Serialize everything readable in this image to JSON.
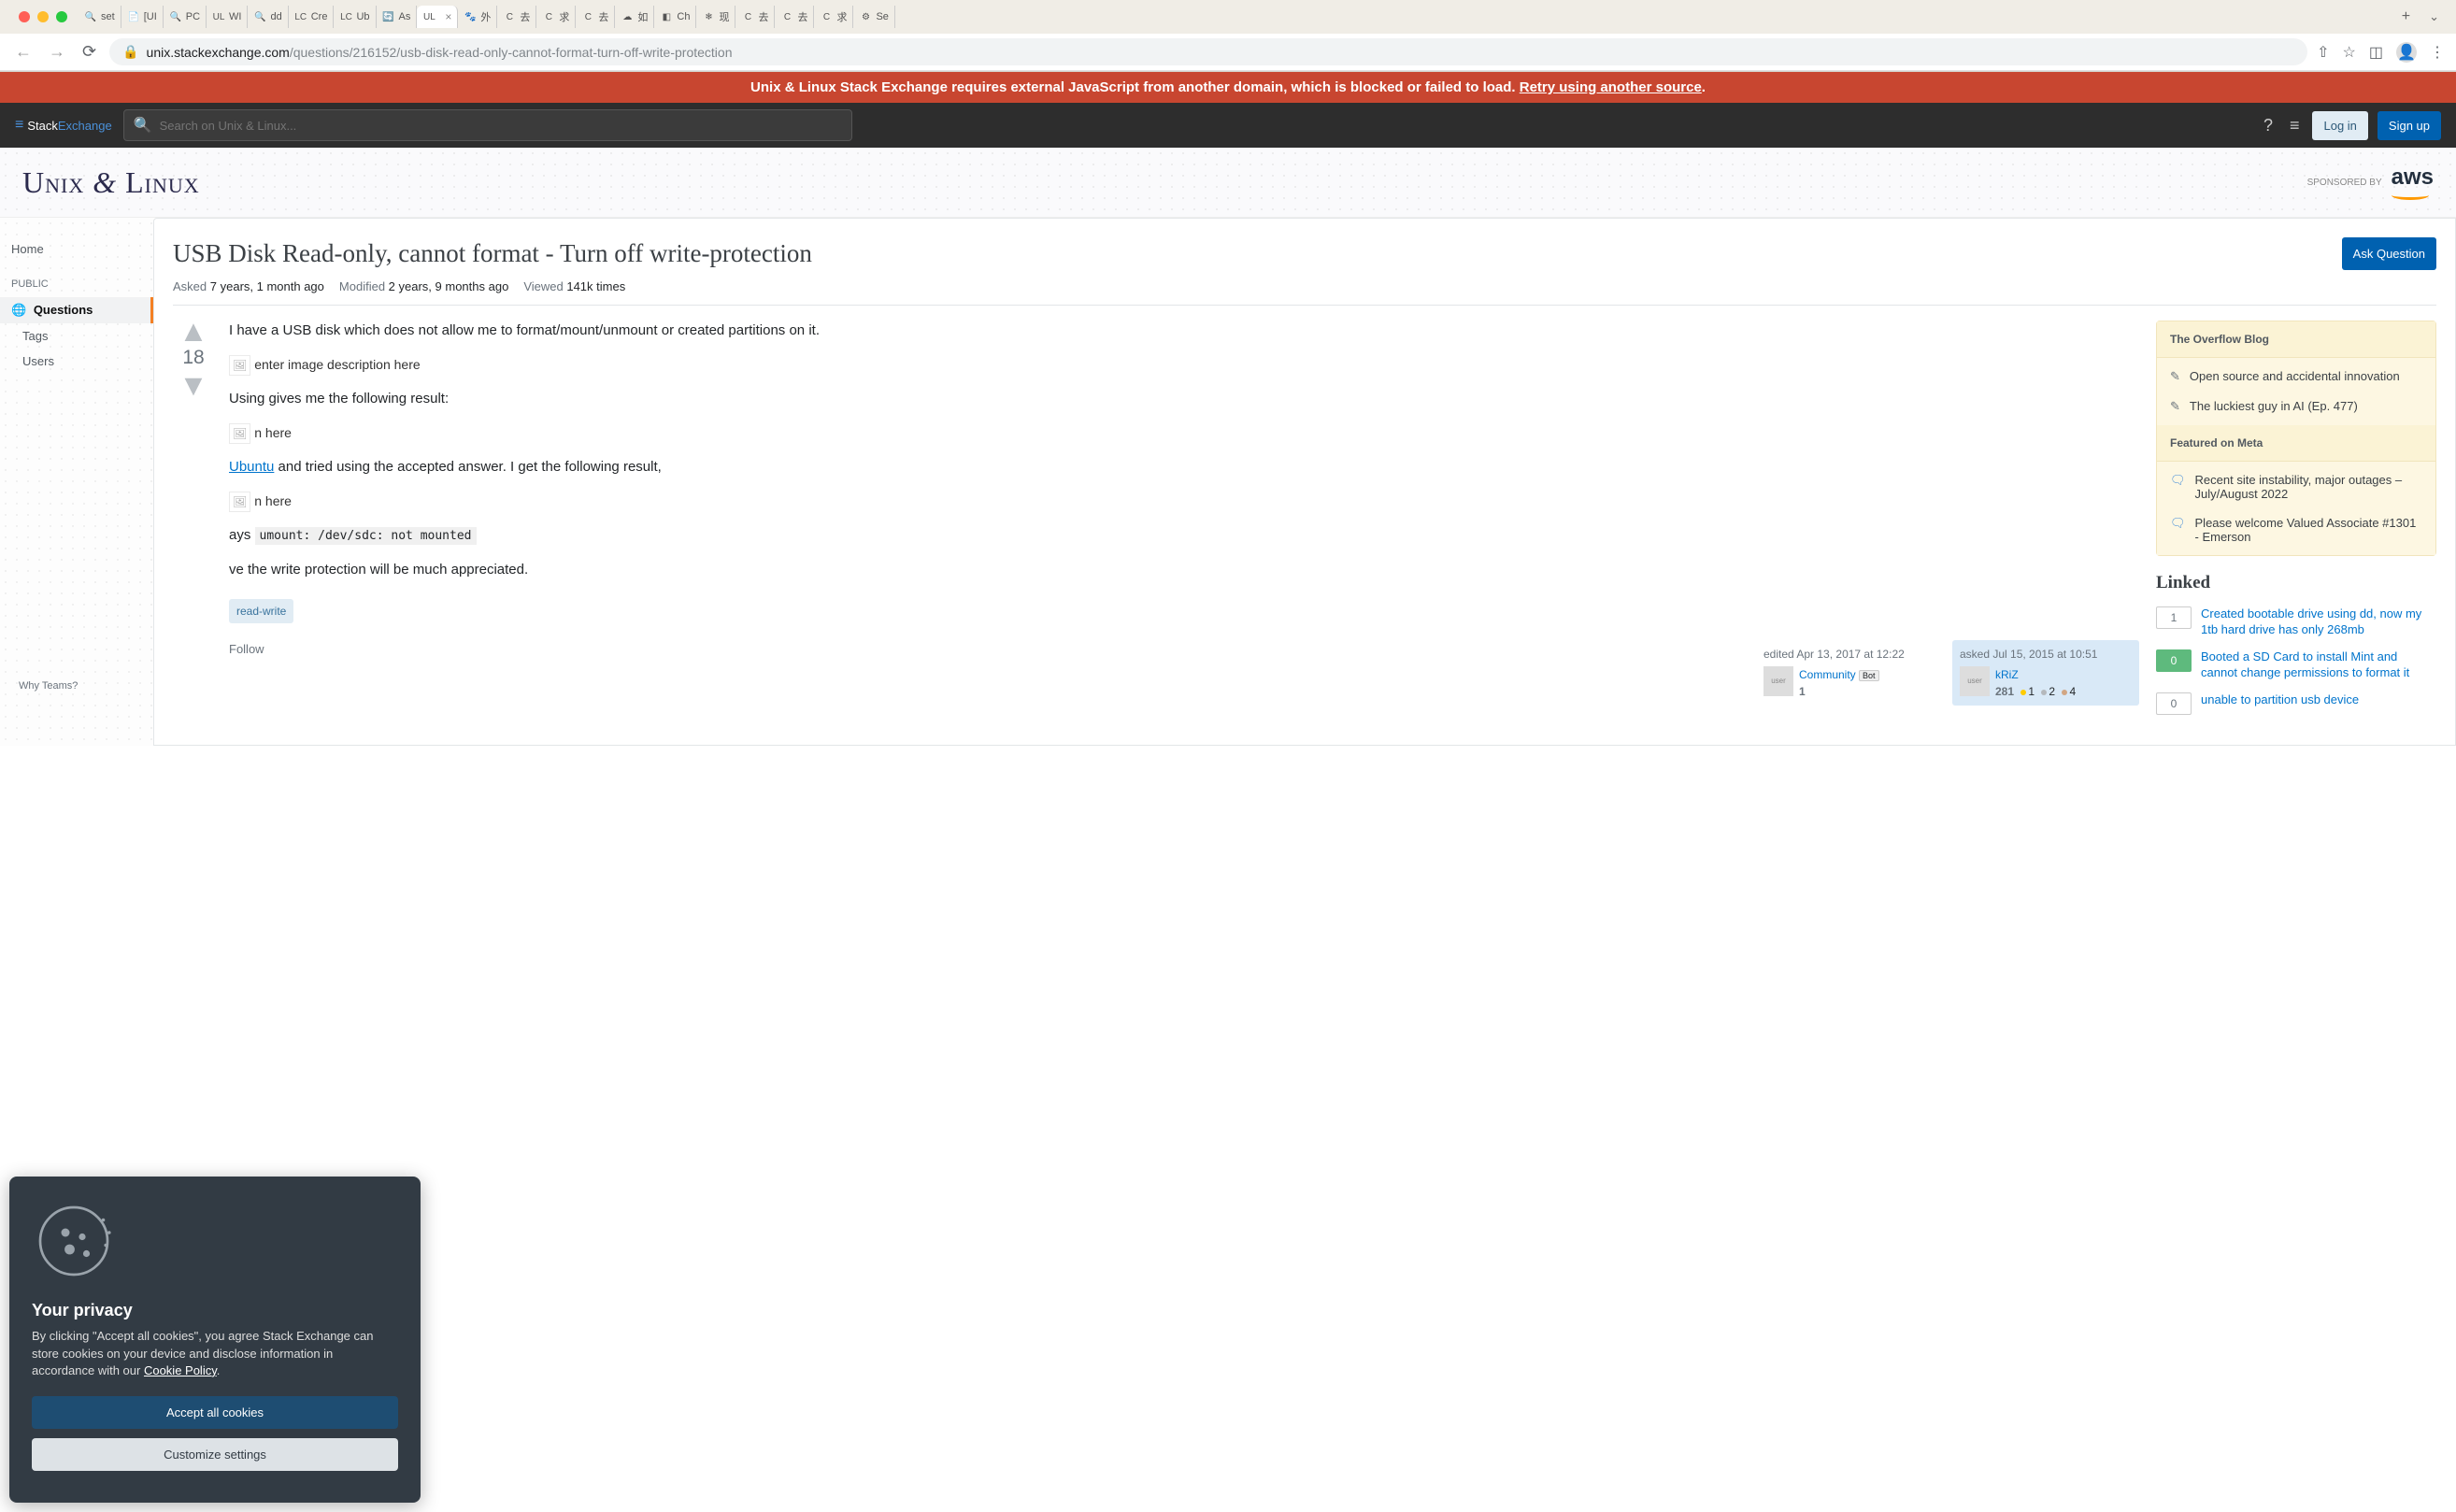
{
  "browser": {
    "tabs": [
      {
        "icon": "🔍",
        "label": "set"
      },
      {
        "icon": "📄",
        "label": "[UI"
      },
      {
        "icon": "🔍",
        "label": "PC"
      },
      {
        "icon": "UL",
        "label": "WI"
      },
      {
        "icon": "🔍",
        "label": "dd"
      },
      {
        "icon": "LC",
        "label": "Cre"
      },
      {
        "icon": "LC",
        "label": "Ub"
      },
      {
        "icon": "🔄",
        "label": "As"
      },
      {
        "icon": "UL",
        "label": "",
        "active": true
      },
      {
        "icon": "🐾",
        "label": "外"
      },
      {
        "icon": "C",
        "label": "去"
      },
      {
        "icon": "C",
        "label": "求"
      },
      {
        "icon": "C",
        "label": "去"
      },
      {
        "icon": "☁",
        "label": "如"
      },
      {
        "icon": "◧",
        "label": "Ch"
      },
      {
        "icon": "❄",
        "label": "现"
      },
      {
        "icon": "C",
        "label": "去"
      },
      {
        "icon": "C",
        "label": "去"
      },
      {
        "icon": "C",
        "label": "求"
      },
      {
        "icon": "⚙",
        "label": "Se"
      }
    ],
    "url_host": "unix.stackexchange.com",
    "url_path": "/questions/216152/usb-disk-read-only-cannot-format-turn-off-write-protection"
  },
  "warning": {
    "text": "Unix & Linux Stack Exchange requires external JavaScript from another domain, which is blocked or failed to load. ",
    "link": "Retry using another source"
  },
  "topnav": {
    "logo_stack": "Stack",
    "logo_exchange": "Exchange",
    "search_placeholder": "Search on Unix & Linux...",
    "login": "Log in",
    "signup": "Sign up"
  },
  "header": {
    "site_name_pre": "Unix ",
    "site_name_amp": "&",
    "site_name_post": " Linux",
    "sponsored_by": "SPONSORED BY",
    "sponsor_name": "aws"
  },
  "sidebar": {
    "home": "Home",
    "public_label": "PUBLIC",
    "questions": "Questions",
    "tags": "Tags",
    "users": "Users",
    "why_teams": "Why Teams?"
  },
  "question": {
    "title": "USB Disk Read-only, cannot format - Turn off write-protection",
    "ask_button": "Ask Question",
    "asked_label": "Asked",
    "asked_value": "7 years, 1 month ago",
    "modified_label": "Modified",
    "modified_value": "2 years, 9 months ago",
    "viewed_label": "Viewed",
    "viewed_value": "141k times",
    "score": "18",
    "body": {
      "p1": "I have a USB disk which does not allow me to format/mount/unmount or created partitions on it.",
      "img1_alt": "enter image description here",
      "p2_pre": "Using ",
      "p2_mid": " gives me the following result:",
      "img2_alt": "n here",
      "p3_link": "Ubuntu",
      "p3_post": " and tried using the accepted answer. I get the following result,",
      "img3_alt": "n here",
      "p4_pre": "ays ",
      "p4_code": "umount: /dev/sdc: not mounted",
      "p5": "ve the write protection will be much appreciated."
    },
    "tags": [
      "read-write"
    ],
    "actions": {
      "follow": "Follow"
    },
    "edit_card": {
      "action": "edited Apr 13, 2017 at 12:22",
      "avatar_alt": "user",
      "user_name": "Community",
      "bot": "Bot",
      "rep": "1"
    },
    "owner_card": {
      "action": "asked Jul 15, 2015 at 10:51",
      "avatar_alt": "user",
      "user_name": "kRiZ",
      "rep": "281",
      "gold": "1",
      "silver": "2",
      "bronze": "4"
    }
  },
  "rightbar": {
    "overflow_blog": "The Overflow Blog",
    "blog_items": [
      "Open source and accidental innovation",
      "The luckiest guy in AI (Ep. 477)"
    ],
    "featured_meta": "Featured on Meta",
    "meta_items": [
      "Recent site instability, major outages – July/August 2022",
      "Please welcome Valued Associate #1301 - Emerson"
    ],
    "linked_header": "Linked",
    "linked": [
      {
        "score": "1",
        "green": false,
        "title": "Created bootable drive using dd, now my 1tb hard drive has only 268mb"
      },
      {
        "score": "0",
        "green": true,
        "title": "Booted a SD Card to install Mint and cannot change permissions to format it"
      },
      {
        "score": "0",
        "green": false,
        "title": "unable to partition usb device"
      }
    ]
  },
  "cookie": {
    "title": "Your privacy",
    "body_pre": "By clicking \"Accept all cookies\", you agree Stack Exchange can store cookies on your device and disclose information in accordance with our ",
    "body_link": "Cookie Policy",
    "body_post": ".",
    "accept": "Accept all cookies",
    "customize": "Customize settings"
  }
}
